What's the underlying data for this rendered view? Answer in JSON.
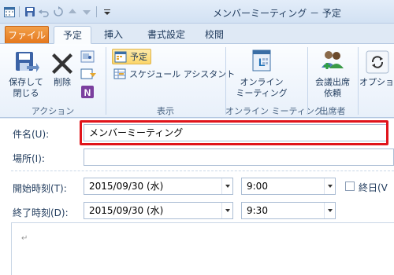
{
  "title_bar": {
    "title": "メンバーミーティング － 予定"
  },
  "ribbon_tabs": [
    {
      "label": "ファイル"
    },
    {
      "label": "予定"
    },
    {
      "label": "挿入"
    },
    {
      "label": "書式設定"
    },
    {
      "label": "校閲"
    }
  ],
  "ribbon": {
    "save_close": "保存して\n閉じる",
    "save_close_1": "保存して",
    "save_close_2": "閉じる",
    "delete": "削除",
    "group_action": "アクション",
    "appointment": "予定",
    "scheduling_assistant": "スケジュール アシスタント",
    "group_show": "表示",
    "online_meeting_1": "オンライン",
    "online_meeting_2": "ミーティング",
    "group_online_meeting": "オンライン ミーティング",
    "request_attendance_1": "会議出席",
    "request_attendance_2": "依頼",
    "group_attendees": "出席者",
    "options": "オプション"
  },
  "form": {
    "subject_label": "件名(U):",
    "subject_value": "メンバーミーティング",
    "location_label": "場所(I):",
    "location_value": "",
    "start_label": "開始時刻(T):",
    "start_date": "2015/09/30 (水)",
    "start_time": "9:00",
    "allday_label": "終日(V",
    "end_label": "終了時刻(D):",
    "end_date": "2015/09/30 (水)",
    "end_time": "9:30",
    "body_mark": "↵"
  },
  "colors": {
    "accent_file_tab": "#e4761b",
    "highlight_red": "#e0141b",
    "ribbon_bg": "#e8f0fa"
  }
}
